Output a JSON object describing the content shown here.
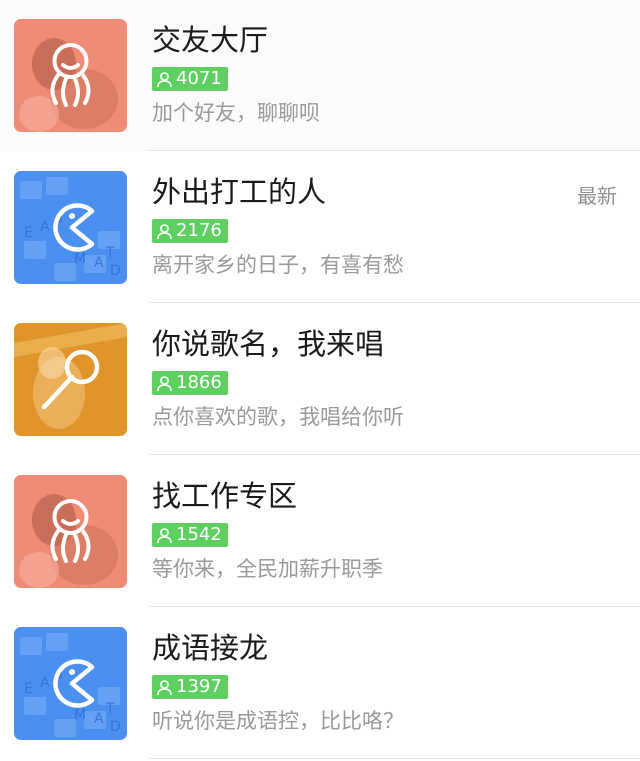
{
  "rooms": [
    {
      "title": "交友大厅",
      "count": "4071",
      "desc": "加个好友，聊聊呗",
      "tag": "",
      "theme": "friends",
      "icon": "friends-icon",
      "bg": "#f08a74"
    },
    {
      "title": "外出打工的人",
      "count": "2176",
      "desc": "离开家乡的日子，有喜有愁",
      "tag": "最新",
      "theme": "game",
      "icon": "pacman-icon",
      "bg": "#4a90f0"
    },
    {
      "title": "你说歌名，我来唱",
      "count": "1866",
      "desc": "点你喜欢的歌，我唱给你听",
      "tag": "",
      "theme": "music",
      "icon": "microphone-icon",
      "bg": "#e0952a"
    },
    {
      "title": "找工作专区",
      "count": "1542",
      "desc": "等你来，全民加薪升职季",
      "tag": "",
      "theme": "friends",
      "icon": "friends-icon",
      "bg": "#f08a74"
    },
    {
      "title": "成语接龙",
      "count": "1397",
      "desc": "听说你是成语控，比比咯？",
      "tag": "",
      "theme": "game",
      "icon": "pacman-icon",
      "bg": "#4a90f0"
    }
  ]
}
